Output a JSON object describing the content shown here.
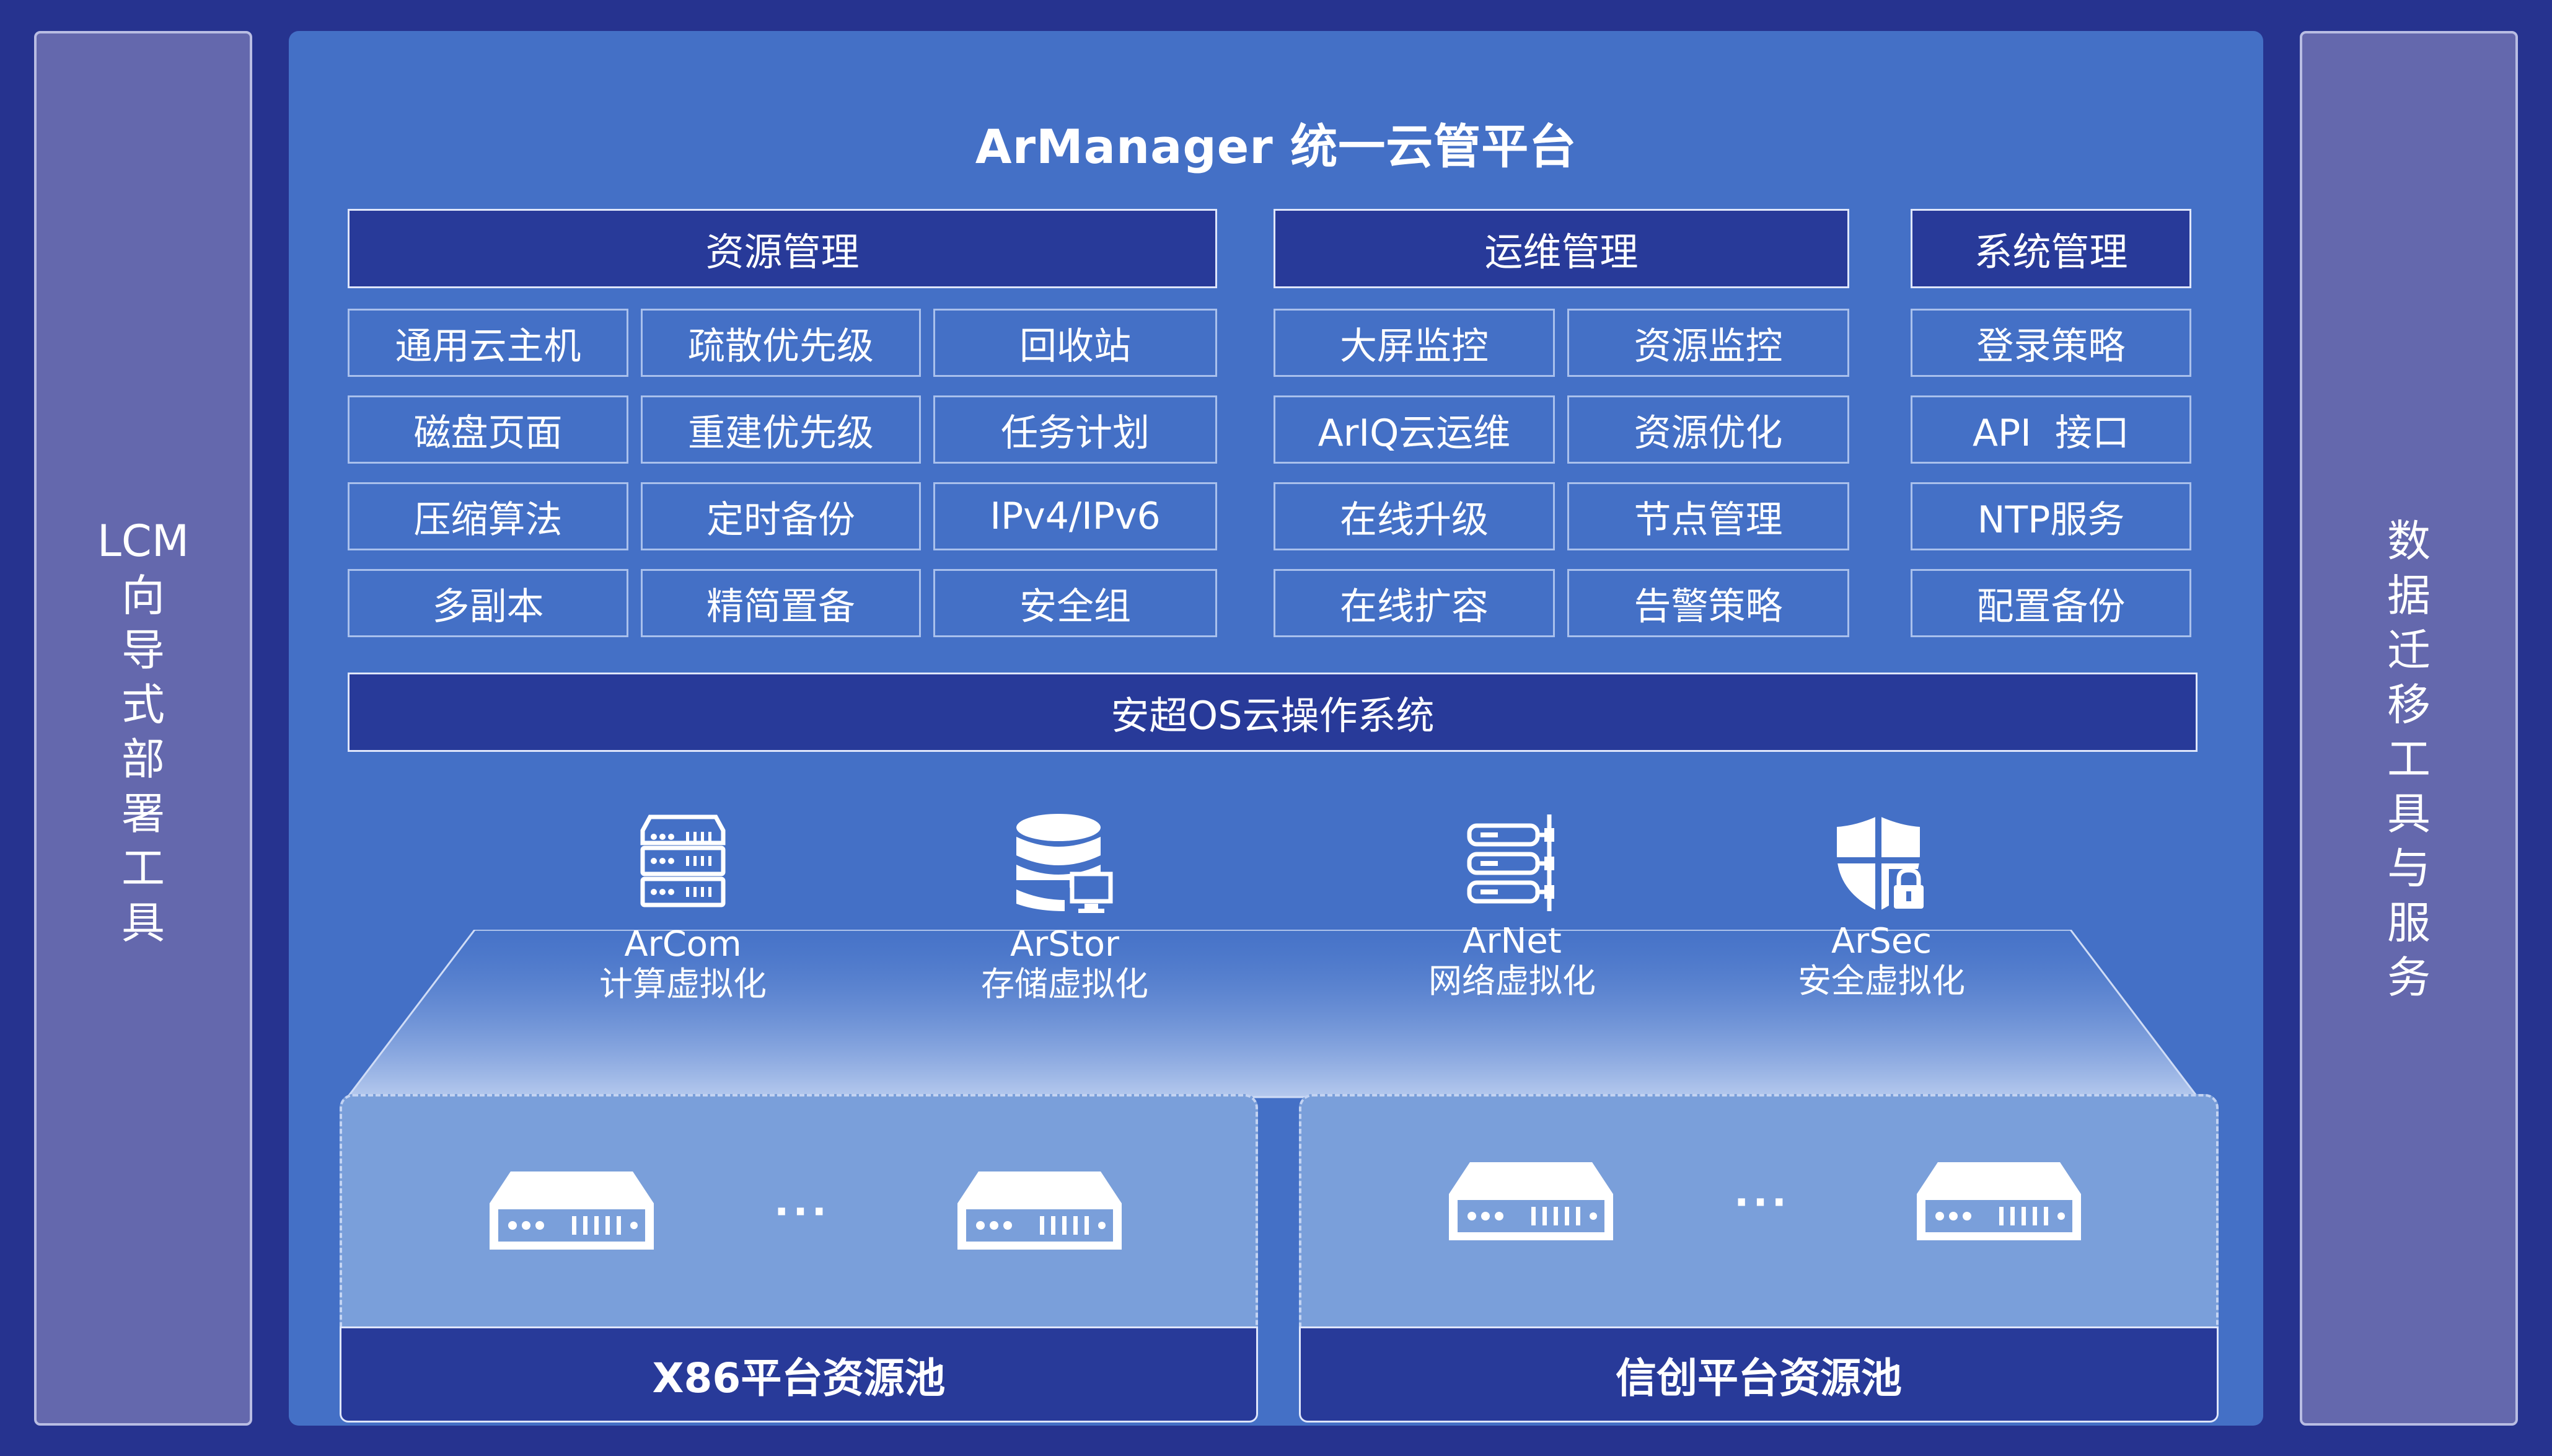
{
  "left_panel": {
    "chars": [
      "LCM",
      "向",
      "导",
      "式",
      "部",
      "署",
      "工",
      "具"
    ]
  },
  "right_panel": {
    "chars": [
      "数",
      "据",
      "迁",
      "移",
      "工",
      "具",
      "与",
      "服",
      "务"
    ]
  },
  "platform": {
    "title": "ArManager 统一云管平台"
  },
  "resource": {
    "header": "资源管理",
    "items": [
      "通用云主机",
      "疏散优先级",
      "回收站",
      "磁盘页面",
      "重建优先级",
      "任务计划",
      "压缩算法",
      "定时备份",
      "IPv4/IPv6",
      "多副本",
      "精简置备",
      "安全组"
    ]
  },
  "ops": {
    "header": "运维管理",
    "items": [
      "大屏监控",
      "资源监控",
      "ArIQ云运维",
      "资源优化",
      "在线升级",
      "节点管理",
      "在线扩容",
      "告警策略"
    ]
  },
  "system": {
    "header": "系统管理",
    "items": [
      "登录策略",
      "API  接口",
      "NTP服务",
      "配置备份"
    ]
  },
  "os": {
    "label": "安超OS云操作系统"
  },
  "virtualization": [
    {
      "name": "ArCom",
      "sub": "计算虚拟化",
      "icon": "server-rack-icon"
    },
    {
      "name": "ArStor",
      "sub": "存储虚拟化",
      "icon": "database-monitor-icon"
    },
    {
      "name": "ArNet",
      "sub": "网络虚拟化",
      "icon": "network-switch-icon"
    },
    {
      "name": "ArSec",
      "sub": "安全虚拟化",
      "icon": "shield-lock-icon"
    }
  ],
  "pools": [
    {
      "label": "X86平台资源池",
      "ellipsis": "···"
    },
    {
      "label": "信创平台资源池",
      "ellipsis": "···"
    }
  ],
  "colors": {
    "background": "#26338f",
    "main_panel": "#4470c6",
    "header_fill": "#283a99",
    "side_panel": "#6468ad",
    "pool_fill": "#7a9fda"
  }
}
